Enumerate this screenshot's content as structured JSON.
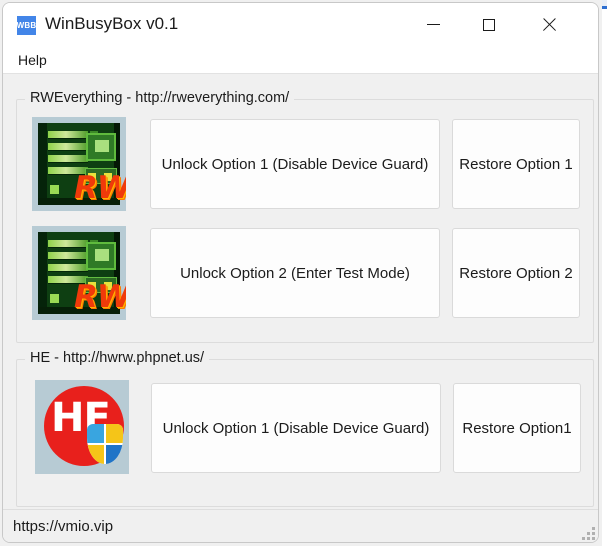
{
  "window": {
    "title": "WinBusyBox v0.1",
    "icon_label": "WBB",
    "controls": {
      "minimize": "minimize-icon",
      "maximize": "maximize-icon",
      "close": "close-icon"
    }
  },
  "menubar": {
    "items": [
      {
        "label": "Help"
      }
    ]
  },
  "groups": [
    {
      "legend": "RWEverything  - http://rweverything.com/",
      "icon_name": "rweverything-logo",
      "icon_letters": "RW",
      "rows": [
        {
          "thumb": "rweverything-circuit-icon",
          "primary_label": "Unlock Option 1 (Disable Device Guard)",
          "secondary_label": "Restore Option 1"
        },
        {
          "thumb": "rweverything-circuit-icon",
          "primary_label": "Unlock Option 2 (Enter Test Mode)",
          "secondary_label": "Restore Option 2"
        }
      ]
    },
    {
      "legend": "HE - http://hwrw.phpnet.us/",
      "icon_name": "he-logo",
      "icon_letters": "HE",
      "rows": [
        {
          "thumb": "he-shield-icon",
          "primary_label": "Unlock Option 1 (Disable Device Guard)",
          "secondary_label": "Restore Option1"
        }
      ]
    }
  ],
  "statusbar": {
    "text": "https://vmio.vip",
    "grip": "resize-grip"
  },
  "colors": {
    "accent_blue": "#4285e8",
    "he_red": "#e8201c",
    "rw_green": "#0e3f12",
    "rw_orange": "#f03a0a",
    "window_bg": "#f0f0f0",
    "button_bg": "#fdfdfd"
  }
}
